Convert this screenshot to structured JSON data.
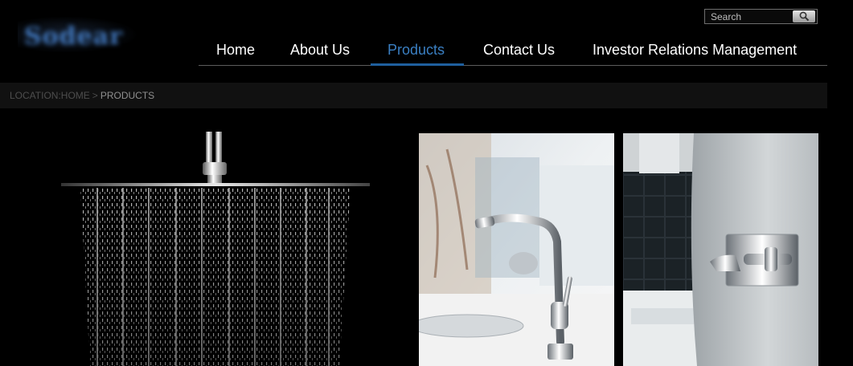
{
  "header": {
    "logo_alt": "Sodear",
    "search": {
      "placeholder": "Search",
      "button_icon": "magnifier-icon"
    }
  },
  "nav": {
    "items": [
      {
        "label": "Home"
      },
      {
        "label": "About Us"
      },
      {
        "label": "Products",
        "active": true
      },
      {
        "label": "Contact Us"
      },
      {
        "label": "Investor Relations Management"
      }
    ],
    "active_color": "#3a7fc2"
  },
  "breadcrumb": {
    "label": "LOCATION:",
    "home": "HOME",
    "separator": ">",
    "current": "PRODUCTS"
  },
  "products": [
    {
      "name": "shower-head-image",
      "icon": "rain-shower-icon"
    },
    {
      "name": "kitchen-faucet-image",
      "icon": "pull-out-faucet-icon"
    },
    {
      "name": "wall-mixer-image",
      "icon": "wall-mixer-icon"
    }
  ]
}
